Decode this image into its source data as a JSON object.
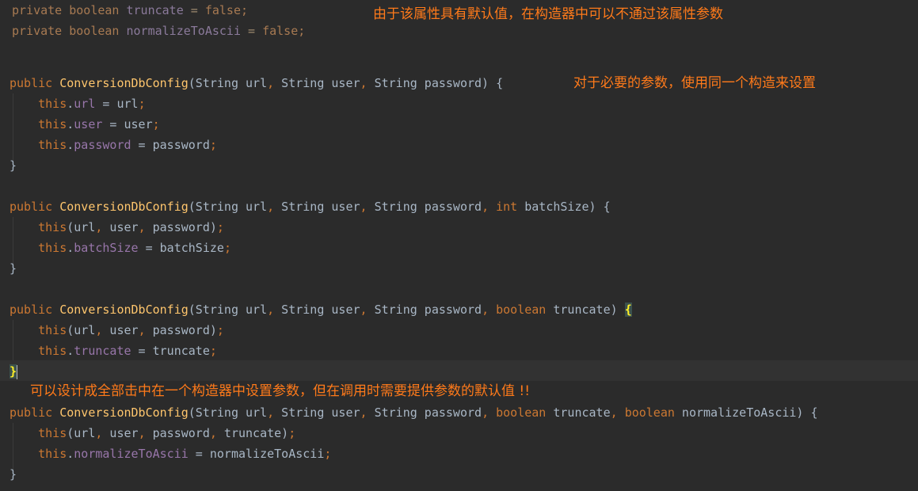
{
  "editor": {
    "fields": {
      "truncate_decl": {
        "modifier": "private",
        "type": "boolean",
        "name": "truncate",
        "value": "false"
      },
      "normalize_decl": {
        "modifier": "private",
        "type": "boolean",
        "name": "normalizeToAscii",
        "value": "false"
      }
    },
    "constructor_name": "ConversionDbConfig",
    "ctor1": {
      "signature_params": "String url, String user, String password",
      "body": [
        "this.url = url;",
        "this.user = user;",
        "this.password = password;"
      ]
    },
    "ctor2": {
      "body": [
        "this(url, user, password);",
        "this.batchSize = batchSize;"
      ]
    },
    "ctor3": {
      "body": [
        "this(url, user, password);",
        "this.truncate = truncate;"
      ]
    },
    "ctor4": {
      "body": [
        "this(url, user, password, truncate);",
        "this.normalizeToAscii = normalizeToAscii;"
      ]
    }
  },
  "annotations": {
    "default_value_note": "由于该属性具有默认值，在构造器中可以不通过该属性参数",
    "required_params_note": "对于必要的参数，使用同一个构造来设置",
    "all_in_one_note": "可以设计成全部击中在一个构造器中设置参数，但在调用时需要提供参数的默认值 !!"
  },
  "colors": {
    "background": "#2b2b2b",
    "keyword": "#cc7832",
    "method": "#ffc66d",
    "field": "#9876aa",
    "text": "#a9b7c6",
    "annotation": "#ff7a1a"
  }
}
